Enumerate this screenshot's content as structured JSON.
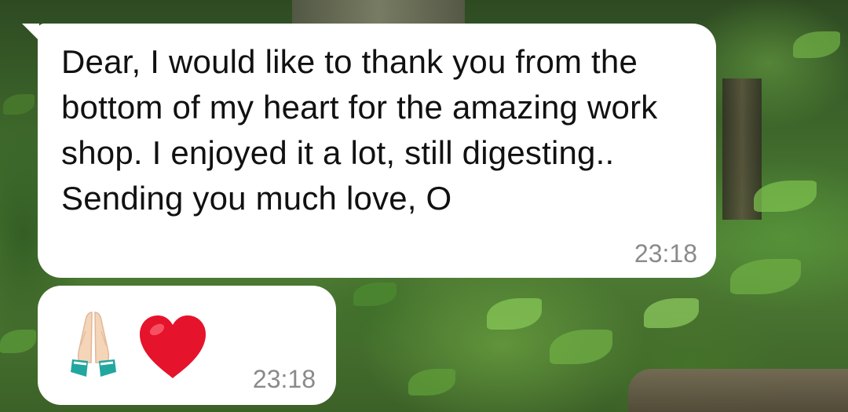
{
  "conversation": {
    "messages": [
      {
        "text": "Dear, I would like to thank you from the bottom of my heart for the amazing work shop. I enjoyed it a lot, still digesting.. Sending you much love, O",
        "time": "23:18"
      },
      {
        "emojis": [
          "folded-hands-icon",
          "red-heart-icon"
        ],
        "time": "23:18"
      }
    ]
  },
  "colors": {
    "bubble": "#ffffff",
    "timestamp": "#8a8a8a",
    "heart": "#e5132b"
  }
}
